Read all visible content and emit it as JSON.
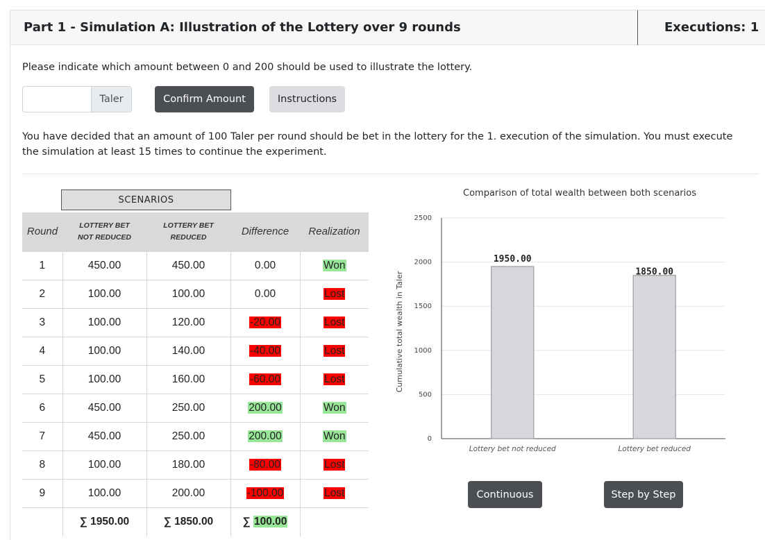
{
  "header": {
    "title": "Part 1 - Simulation A: Illustration of the Lottery over 9 rounds",
    "executions": "Executions: 1"
  },
  "prompt": "Please indicate which amount between 0 and 200 should be used to illustrate the lottery.",
  "amount_input": {
    "value": "",
    "placeholder": "",
    "unit": "Taler"
  },
  "buttons": {
    "confirm": "Confirm Amount",
    "instructions": "Instructions",
    "continuous": "Continuous",
    "step_by_step": "Step by Step"
  },
  "info": "You have decided that an amount of 100 Taler per round should be bet in the lottery for the 1. execution of the simulation. You must execute the simulation at least 15 times to continue the experiment.",
  "table": {
    "scenarios_label": "SCENARIOS",
    "headers": {
      "round": "Round",
      "not_reduced_line1": "LOTTERY BET",
      "not_reduced_line2": "NOT REDUCED",
      "reduced_line1": "LOTTERY BET",
      "reduced_line2": "REDUCED",
      "difference": "Difference",
      "realization": "Realization"
    },
    "rows": [
      {
        "round": "1",
        "not_reduced": "450.00",
        "reduced": "450.00",
        "difference": "0.00",
        "diff_status": "none",
        "realization": "Won"
      },
      {
        "round": "2",
        "not_reduced": "100.00",
        "reduced": "100.00",
        "difference": "0.00",
        "diff_status": "none",
        "realization": "Lost"
      },
      {
        "round": "3",
        "not_reduced": "100.00",
        "reduced": "120.00",
        "difference": "-20.00",
        "diff_status": "negative",
        "realization": "Lost"
      },
      {
        "round": "4",
        "not_reduced": "100.00",
        "reduced": "140.00",
        "difference": "-40.00",
        "diff_status": "negative",
        "realization": "Lost"
      },
      {
        "round": "5",
        "not_reduced": "100.00",
        "reduced": "160.00",
        "difference": "-60.00",
        "diff_status": "negative",
        "realization": "Lost"
      },
      {
        "round": "6",
        "not_reduced": "450.00",
        "reduced": "250.00",
        "difference": "200.00",
        "diff_status": "positive",
        "realization": "Won"
      },
      {
        "round": "7",
        "not_reduced": "450.00",
        "reduced": "250.00",
        "difference": "200.00",
        "diff_status": "positive",
        "realization": "Won"
      },
      {
        "round": "8",
        "not_reduced": "100.00",
        "reduced": "180.00",
        "difference": "-80.00",
        "diff_status": "negative",
        "realization": "Lost"
      },
      {
        "round": "9",
        "not_reduced": "100.00",
        "reduced": "200.00",
        "difference": "-100.00",
        "diff_status": "negative",
        "realization": "Lost"
      }
    ],
    "totals": {
      "round": "",
      "not_reduced": "∑ 1950.00",
      "reduced": "∑ 1850.00",
      "difference_prefix": "∑ ",
      "difference": "100.00",
      "realization": ""
    }
  },
  "colors": {
    "won": "#98e698",
    "lost": "#ff0000",
    "bar_fill": "#d7d8db",
    "bar_stroke": "#a9abb0"
  },
  "chart_data": {
    "type": "bar",
    "title": "Comparison of total wealth between both scenarios",
    "ylabel": "Cumulative total wealth in Taler",
    "xlabel": "",
    "categories": [
      "Lottery bet not reduced",
      "Lottery bet reduced"
    ],
    "values": [
      1950,
      1850
    ],
    "data_labels": [
      "1950.00",
      "1850.00"
    ],
    "ylim": [
      0,
      2500
    ],
    "yticks": [
      0,
      500,
      1000,
      1500,
      2000,
      2500
    ],
    "grid": true
  }
}
